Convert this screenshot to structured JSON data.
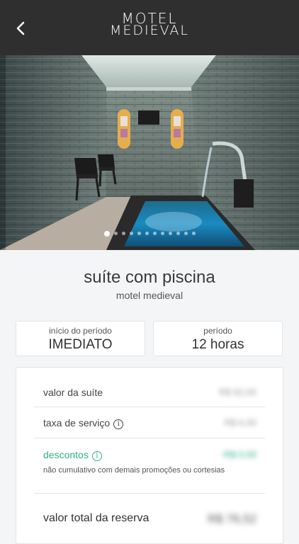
{
  "header": {
    "back_icon": "chevron-left-icon",
    "logo_line1": "MOTEL",
    "logo_line2": "MEDIEVAL",
    "background": "#2f2f2f"
  },
  "gallery": {
    "image_alt": "",
    "dot_count": 12,
    "active_dot": 0
  },
  "suite": {
    "name": "suíte com piscina",
    "motel": "motel medieval"
  },
  "period": {
    "start_label": "início do período",
    "start_value": "IMEDIATO",
    "duration_label": "período",
    "duration_value": "12 horas"
  },
  "pricing": {
    "suite_label": "valor da suíte",
    "suite_value": "R$ 62,00",
    "fee_label": "taxa de serviço",
    "fee_value": "R$ 6,00",
    "discount_label": "descontos",
    "discount_value": "-R$ 0,00",
    "discount_note": "não cumulativo com demais promoções ou cortesias",
    "total_label": "valor total da reserva",
    "total_value": "R$ 76,52",
    "discount_color": "#2bb08a"
  }
}
